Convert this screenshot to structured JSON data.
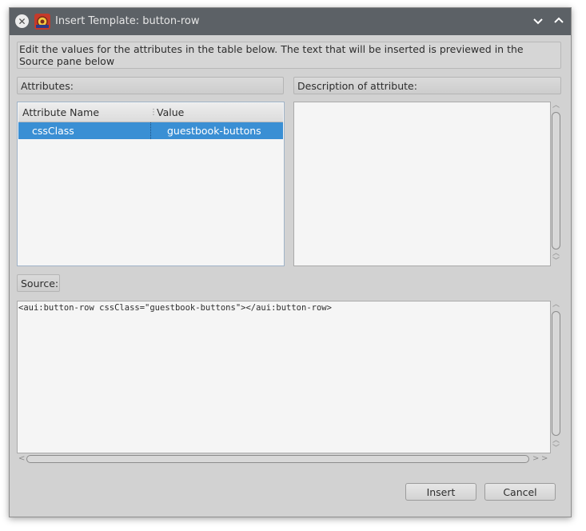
{
  "window": {
    "title": "Insert Template: button-row",
    "icons": {
      "close": "close-icon",
      "app": "app-icon",
      "minimize": "chevron-down-icon",
      "maximize": "chevron-up-icon"
    }
  },
  "instructions": "Edit the values for the attributes in the table below.  The text that will be inserted is previewed in the Source pane below",
  "attributes": {
    "header": "Attributes:",
    "columns": {
      "name": "Attribute Name",
      "value": "Value"
    },
    "rows": [
      {
        "name": "cssClass",
        "value": "guestbook-buttons",
        "selected": true
      }
    ]
  },
  "description": {
    "header": "Description of attribute:",
    "text": ""
  },
  "source": {
    "label": "Source:",
    "code": "<aui:button-row cssClass=\"guestbook-buttons\"></aui:button-row>"
  },
  "buttons": {
    "insert": "Insert",
    "cancel": "Cancel"
  },
  "colors": {
    "titlebar": "#5c6166",
    "selection": "#3a8fd4",
    "dialog_bg": "#d2d2d2"
  }
}
